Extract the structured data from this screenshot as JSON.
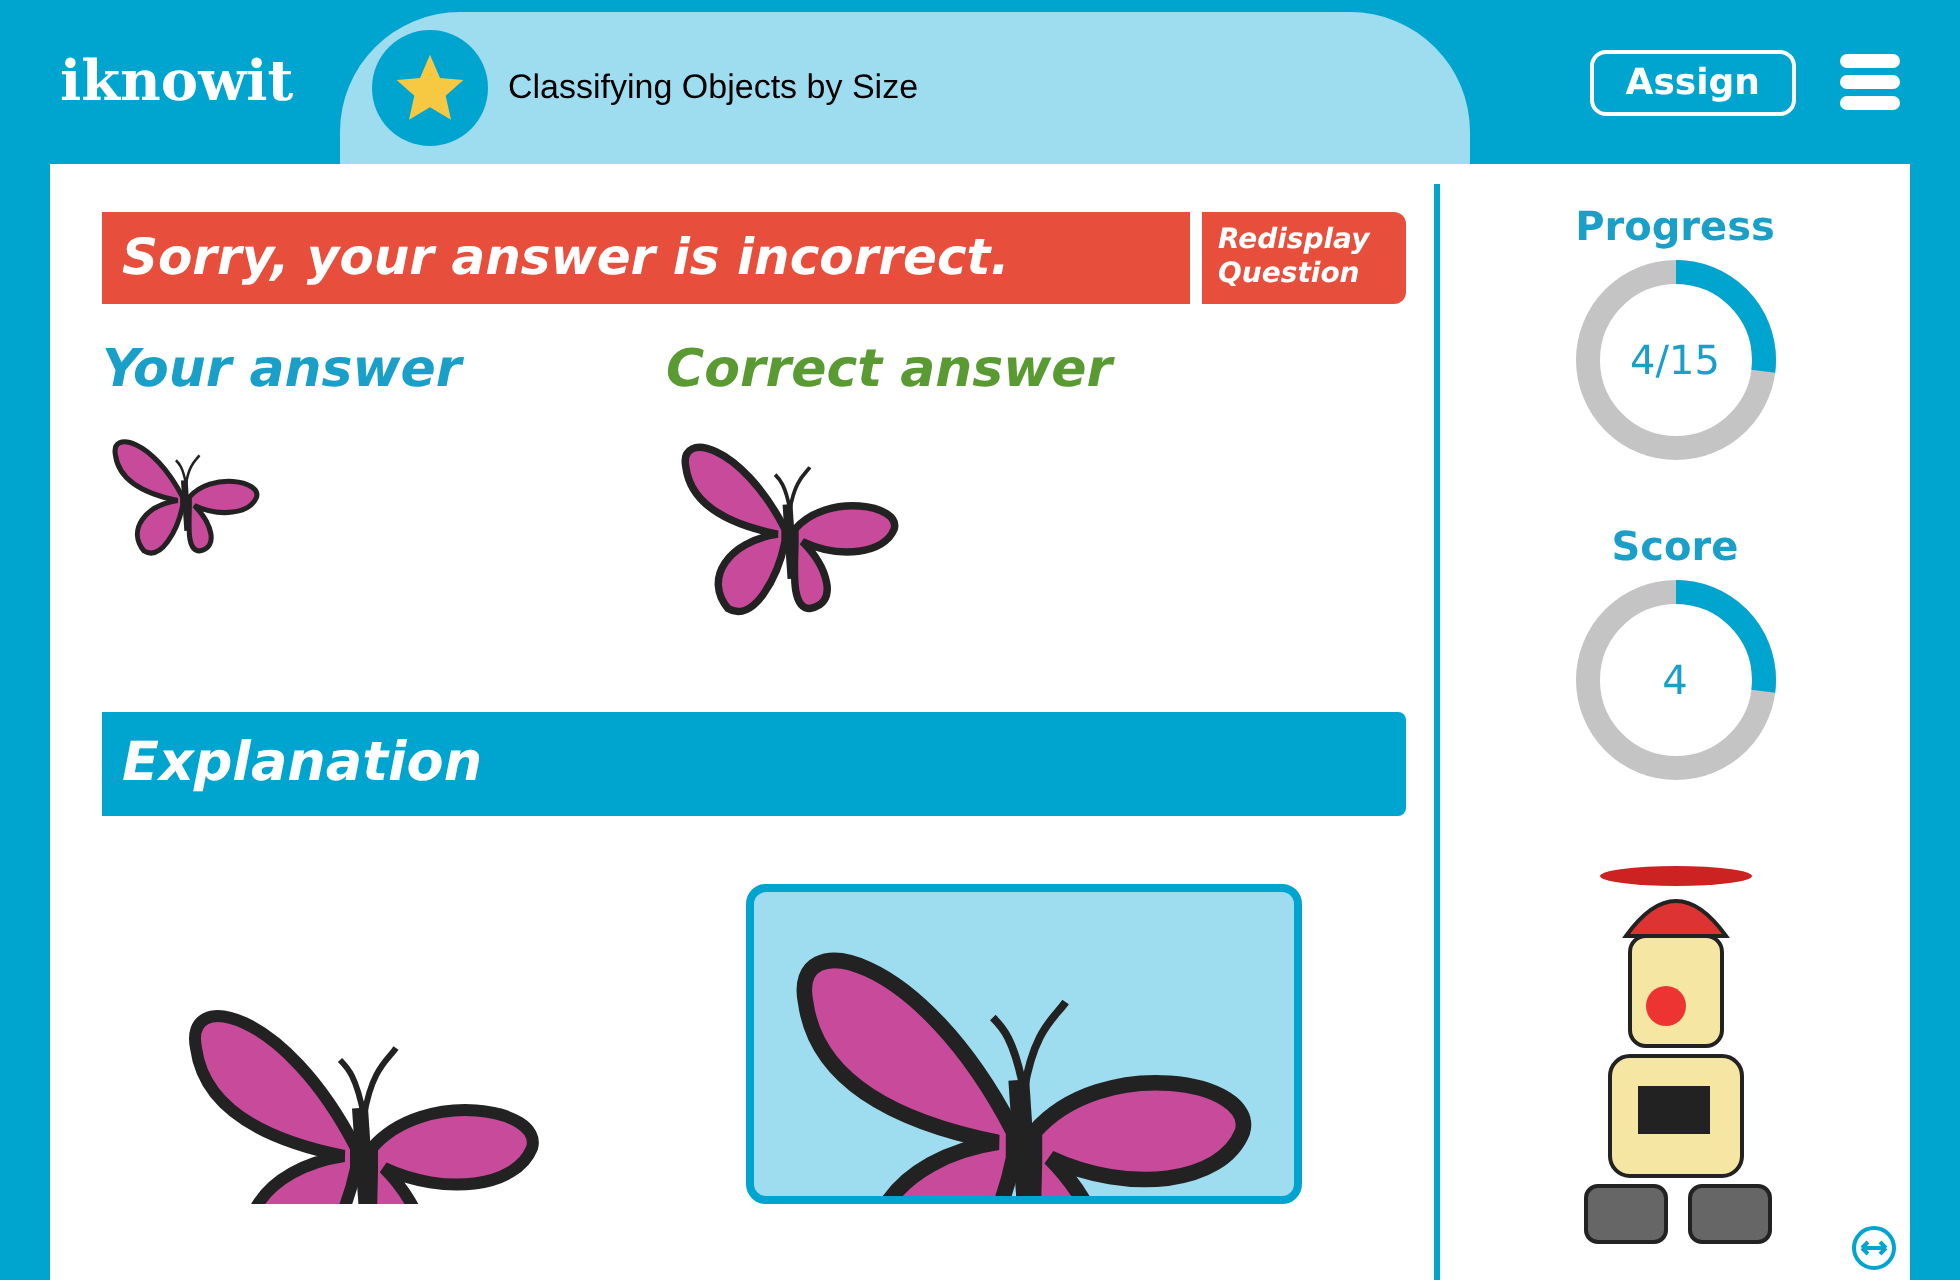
{
  "header": {
    "logo": "iknowit",
    "lesson_title": "Classifying Objects by Size",
    "assign_button": "Assign"
  },
  "feedback": {
    "message": "Sorry, your answer is incorrect.",
    "redisplay_button": "Redisplay Question"
  },
  "answers": [
    {
      "kind": "yours",
      "label": "Your answer"
    },
    {
      "kind": "correct",
      "label": "Correct answer"
    }
  ],
  "explanation": {
    "title": "Explanation",
    "images": [
      {
        "highlighted": false
      },
      {
        "highlighted": true
      }
    ]
  },
  "stats": [
    {
      "label": "Progress",
      "value": "4/15",
      "level": 0.27
    },
    {
      "label": "Score",
      "value": "4",
      "level": 0.27
    }
  ]
}
